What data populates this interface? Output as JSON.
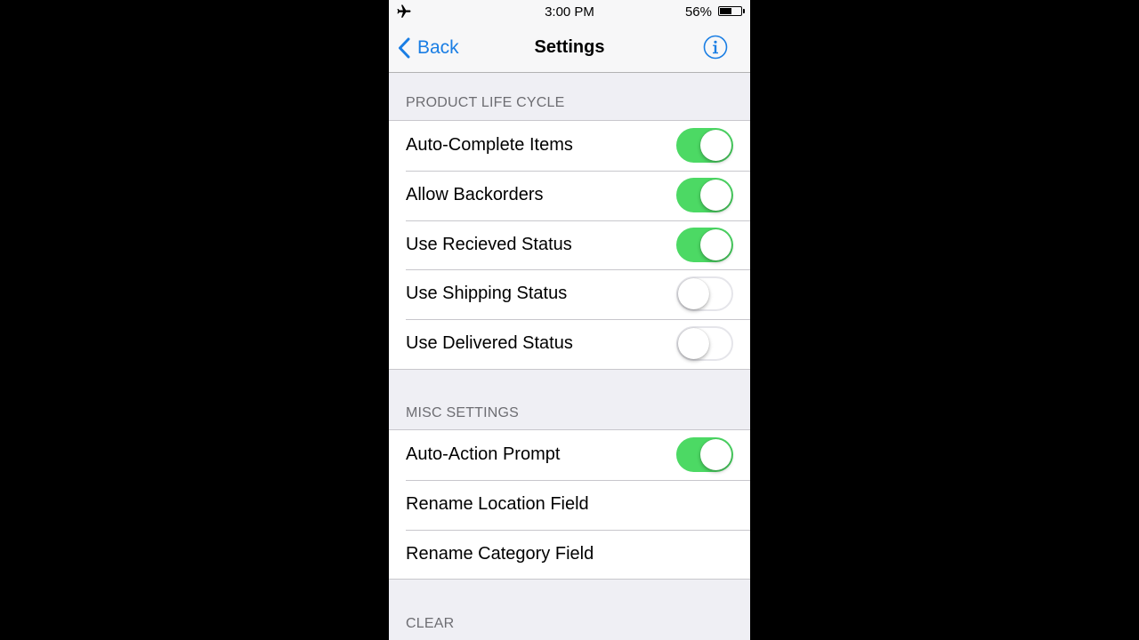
{
  "status_bar": {
    "time": "3:00 PM",
    "battery_percent": "56%",
    "battery_level": 0.56,
    "airplane_icon": "airplane-icon"
  },
  "nav": {
    "back_label": "Back",
    "title": "Settings",
    "info_icon": "info-icon"
  },
  "sections": {
    "product_life_cycle": {
      "header": "PRODUCT LIFE CYCLE",
      "items": [
        {
          "label": "Auto-Complete Items",
          "toggle": true
        },
        {
          "label": "Allow Backorders",
          "toggle": true
        },
        {
          "label": "Use Recieved Status",
          "toggle": true
        },
        {
          "label": "Use Shipping Status",
          "toggle": false
        },
        {
          "label": "Use Delivered Status",
          "toggle": false
        }
      ]
    },
    "misc_settings": {
      "header": "MISC SETTINGS",
      "items": [
        {
          "label": "Auto-Action Prompt",
          "toggle": true
        },
        {
          "label": "Rename Location Field"
        },
        {
          "label": "Rename Category Field"
        }
      ]
    },
    "clear": {
      "header": "CLEAR"
    }
  },
  "colors": {
    "accent": "#1a7ee4",
    "switch_on": "#4cd964",
    "background": "#efeff4"
  }
}
